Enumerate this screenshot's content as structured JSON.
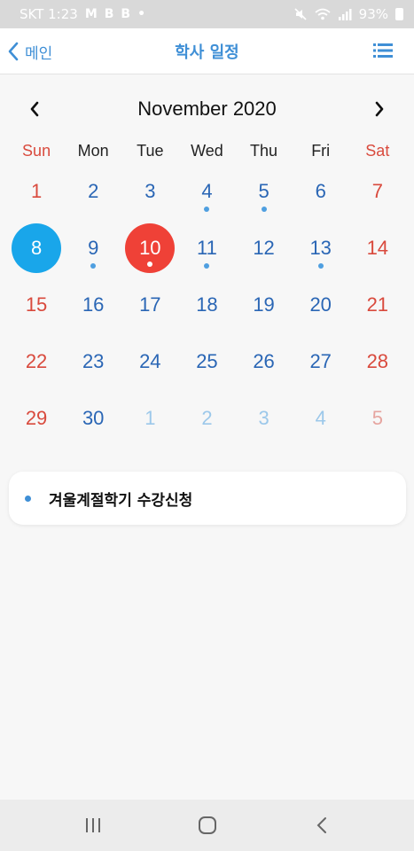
{
  "status_bar": {
    "carrier_time": "SKT 1:23",
    "notif_icons": [
      "M",
      "B",
      "B",
      "•"
    ],
    "battery": "93%"
  },
  "header": {
    "back_label": "메인",
    "title": "학사 일정"
  },
  "calendar": {
    "month_label": "November 2020",
    "weekdays": [
      "Sun",
      "Mon",
      "Tue",
      "Wed",
      "Thu",
      "Fri",
      "Sat"
    ],
    "days": [
      {
        "n": "1",
        "other": false,
        "dot": false
      },
      {
        "n": "2",
        "other": false,
        "dot": false
      },
      {
        "n": "3",
        "other": false,
        "dot": false
      },
      {
        "n": "4",
        "other": false,
        "dot": true
      },
      {
        "n": "5",
        "other": false,
        "dot": true
      },
      {
        "n": "6",
        "other": false,
        "dot": false
      },
      {
        "n": "7",
        "other": false,
        "dot": false
      },
      {
        "n": "8",
        "other": false,
        "dot": false,
        "selected": true
      },
      {
        "n": "9",
        "other": false,
        "dot": true
      },
      {
        "n": "10",
        "other": false,
        "dot": true,
        "today": true
      },
      {
        "n": "11",
        "other": false,
        "dot": true
      },
      {
        "n": "12",
        "other": false,
        "dot": false
      },
      {
        "n": "13",
        "other": false,
        "dot": true
      },
      {
        "n": "14",
        "other": false,
        "dot": false
      },
      {
        "n": "15",
        "other": false,
        "dot": false
      },
      {
        "n": "16",
        "other": false,
        "dot": false
      },
      {
        "n": "17",
        "other": false,
        "dot": false
      },
      {
        "n": "18",
        "other": false,
        "dot": false
      },
      {
        "n": "19",
        "other": false,
        "dot": false
      },
      {
        "n": "20",
        "other": false,
        "dot": false
      },
      {
        "n": "21",
        "other": false,
        "dot": false
      },
      {
        "n": "22",
        "other": false,
        "dot": false
      },
      {
        "n": "23",
        "other": false,
        "dot": false
      },
      {
        "n": "24",
        "other": false,
        "dot": false
      },
      {
        "n": "25",
        "other": false,
        "dot": false
      },
      {
        "n": "26",
        "other": false,
        "dot": false
      },
      {
        "n": "27",
        "other": false,
        "dot": false
      },
      {
        "n": "28",
        "other": false,
        "dot": false
      },
      {
        "n": "29",
        "other": false,
        "dot": false
      },
      {
        "n": "30",
        "other": false,
        "dot": false
      },
      {
        "n": "1",
        "other": true,
        "dot": false
      },
      {
        "n": "2",
        "other": true,
        "dot": false
      },
      {
        "n": "3",
        "other": true,
        "dot": false
      },
      {
        "n": "4",
        "other": true,
        "dot": false
      },
      {
        "n": "5",
        "other": true,
        "dot": false
      }
    ]
  },
  "events": [
    {
      "title": "겨울계절학기 수강신청"
    }
  ],
  "colors": {
    "accent": "#3f8fd6",
    "weekday_text": "#2a66b5",
    "weekend_text": "#d94a3d",
    "selected": "#19a6ea",
    "today": "#ef4137"
  },
  "icons": {
    "back": "chevron-left-icon",
    "menu": "list-icon",
    "prev": "chevron-left-icon",
    "next": "chevron-right-icon",
    "recents": "recents-icon",
    "home": "home-icon",
    "nav_back": "back-icon"
  }
}
